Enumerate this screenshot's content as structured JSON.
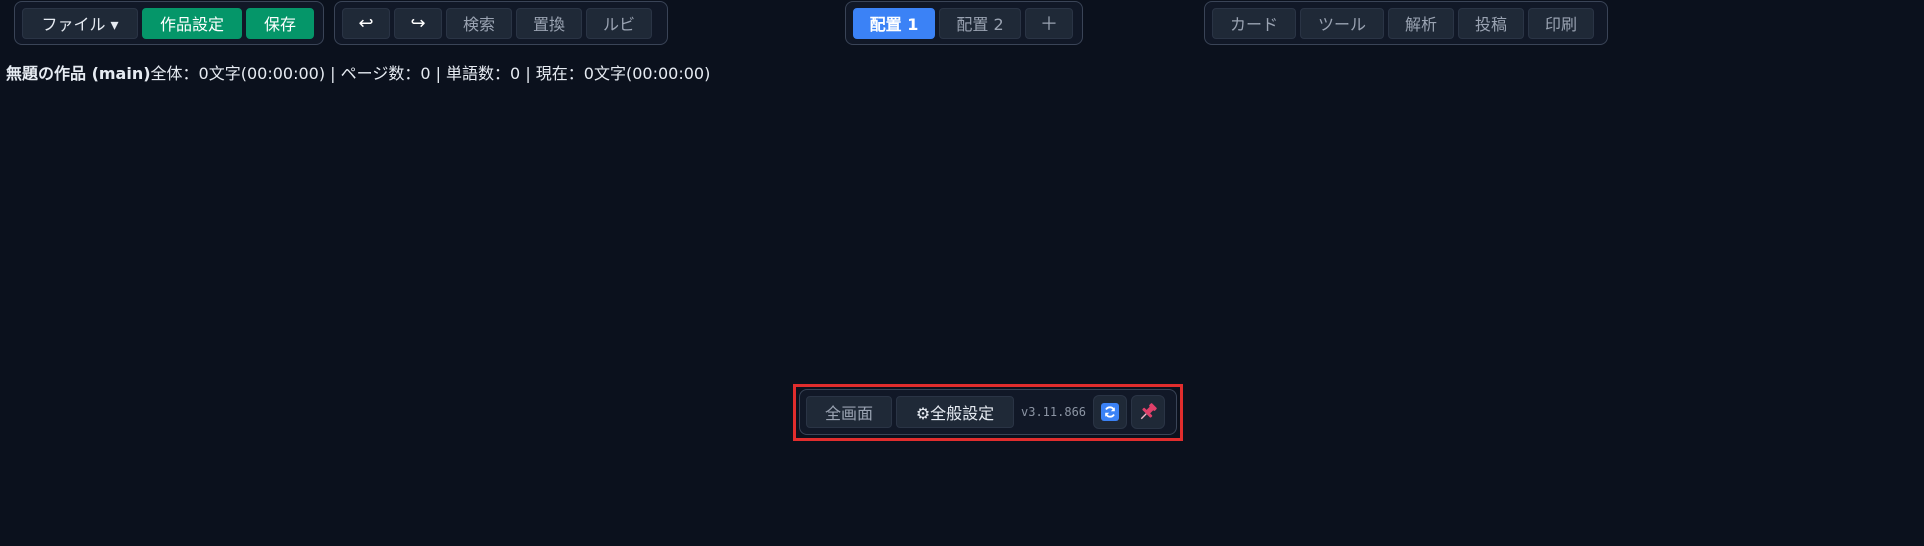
{
  "toolbar": {
    "file_menu": "ファイル ▾",
    "work_settings": "作品設定",
    "save": "保存",
    "undo_icon": "↩",
    "redo_icon": "↪",
    "search": "検索",
    "replace": "置換",
    "ruby": "ルビ",
    "layout1": "配置 1",
    "layout2": "配置 2",
    "add_layout": "＋",
    "card": "カード",
    "tools": "ツール",
    "analysis": "解析",
    "post": "投稿",
    "print": "印刷"
  },
  "status": {
    "title": "無題の作品 (main)",
    "stats": "全体：0文字(00:00:00) | ページ数：0 | 単語数：0 | 現在：0文字(00:00:00)"
  },
  "footer": {
    "fullscreen": "全画面",
    "general_settings": "⚙全般設定",
    "version": "v3.11.866",
    "refresh_icon": "refresh-icon",
    "pin_icon": "pin-icon"
  },
  "colors": {
    "background": "#0b111d",
    "accent_green": "#059669",
    "accent_blue": "#3b82f6",
    "highlight_red": "#e12d2d"
  }
}
